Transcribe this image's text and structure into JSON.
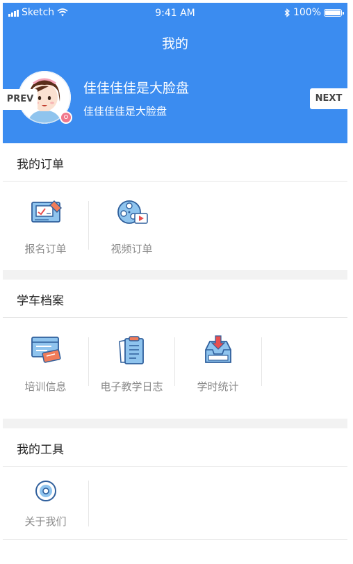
{
  "status_bar": {
    "carrier": "Sketch",
    "time": "9:41 AM",
    "battery": "100%",
    "signal_icon": "signal-bars-icon",
    "wifi_icon": "wifi-icon",
    "bluetooth_icon": "bluetooth-icon",
    "battery_icon": "battery-icon"
  },
  "header": {
    "title": "我的",
    "user_name": "佳佳佳佳是大脸盘",
    "user_subtitle": "佳佳佳佳是大脸盘",
    "prev_label": "PREV",
    "next_label": "NEXT",
    "background_color": "#3b8cf0"
  },
  "sections": [
    {
      "title": "我的订单",
      "items": [
        {
          "label": "报名订单",
          "icon": "registration-order-icon"
        },
        {
          "label": "视频订单",
          "icon": "video-order-icon"
        }
      ]
    },
    {
      "title": "学车档案",
      "items": [
        {
          "label": "培训信息",
          "icon": "training-info-icon"
        },
        {
          "label": "电子教学日志",
          "icon": "teaching-log-icon"
        },
        {
          "label": "学时统计",
          "icon": "study-hours-icon"
        }
      ]
    },
    {
      "title": "我的工具",
      "items": [
        {
          "label": "关于我们",
          "icon": "about-us-icon"
        }
      ]
    }
  ]
}
